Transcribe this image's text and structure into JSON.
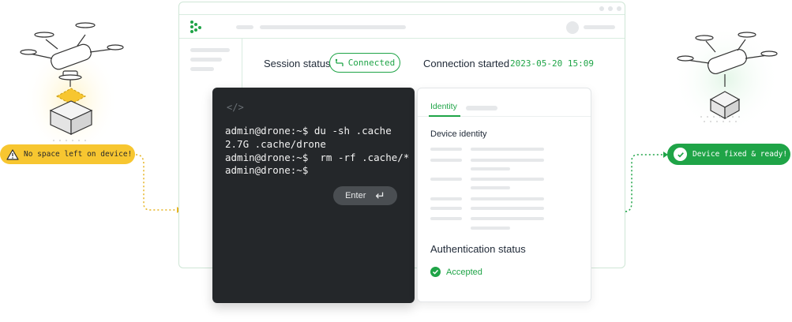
{
  "session": {
    "status_label": "Session status",
    "status_value": "Connected",
    "started_label": "Connection started",
    "started_value": "2023-05-20 15:09"
  },
  "terminal": {
    "code_icon": "</>",
    "lines": [
      "admin@drone:~$ du -sh .cache",
      "2.7G .cache/drone",
      "admin@drone:~$  rm -rf .cache/*",
      "admin@drone:~$"
    ],
    "enter_label": "Enter",
    "enter_icon": "↵"
  },
  "identity_card": {
    "tab_active": "Identity",
    "device_identity_label": "Device identity",
    "auth_title": "Authentication status",
    "auth_value": "Accepted"
  },
  "badges": {
    "warning": "No space left on device!",
    "success": "Device fixed & ready!"
  },
  "icons": {
    "warning": "warning-triangle-icon",
    "check": "check-circle-icon",
    "connected": "connection-icon",
    "enter": "enter-arrow-icon"
  },
  "colors": {
    "accent_green": "#1fa447",
    "warning_yellow": "#f7c630",
    "terminal_bg": "#24272a"
  }
}
